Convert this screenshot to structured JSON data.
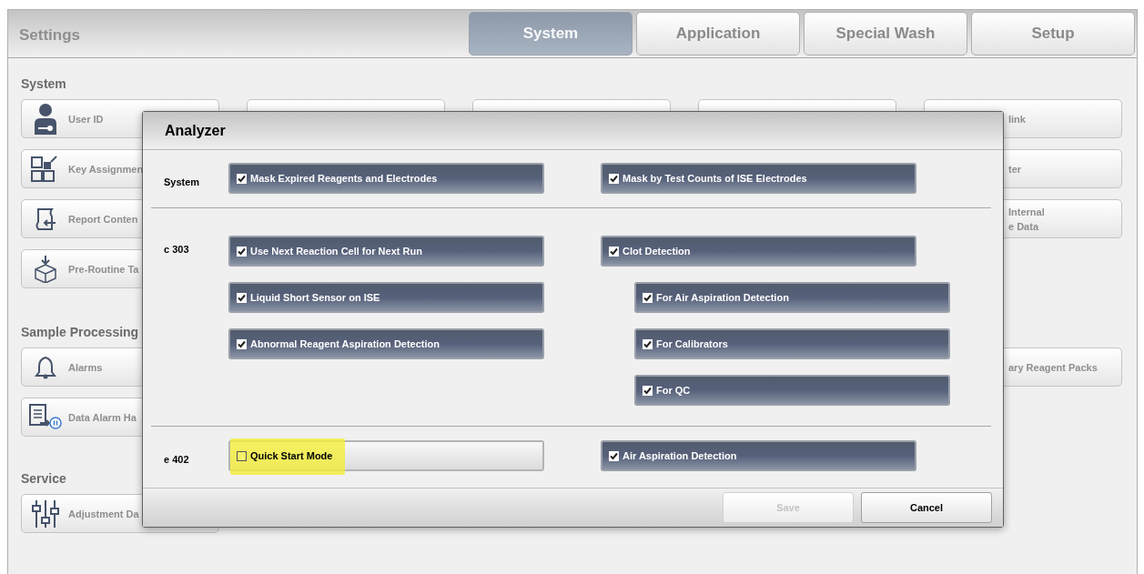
{
  "header": {
    "title": "Settings",
    "tabs": [
      {
        "label": "System",
        "selected": true
      },
      {
        "label": "Application",
        "selected": false
      },
      {
        "label": "Special Wash",
        "selected": false
      },
      {
        "label": "Setup",
        "selected": false
      }
    ]
  },
  "background": {
    "sections": [
      {
        "title": "System",
        "rows": [
          [
            {
              "label": "User ID"
            },
            {},
            {},
            {},
            {
              "label": "link"
            }
          ],
          [
            {
              "label": "Key Assignmen"
            },
            null,
            null,
            null,
            {
              "label": "ter"
            }
          ],
          [
            {
              "label": "Report Conten"
            },
            null,
            null,
            null,
            {
              "label": "Internal\ne Data"
            }
          ],
          [
            {
              "label": "Pre-Routine Ta"
            },
            null,
            null,
            null,
            null
          ]
        ]
      },
      {
        "title": "Sample Processing",
        "rows": [
          [
            {
              "label": "Alarms"
            },
            null,
            null,
            null,
            {
              "label": "ary Reagent Packs"
            }
          ],
          [
            {
              "label": "Data Alarm Ha"
            },
            null,
            null,
            null,
            null
          ]
        ]
      },
      {
        "title": "Service",
        "rows": [
          [
            {
              "label": "Adjustment Da"
            },
            null,
            null,
            null,
            null
          ]
        ]
      }
    ]
  },
  "dialog": {
    "title": "Analyzer",
    "sections": [
      {
        "label": "System",
        "left": [
          {
            "label": "Mask Expired Reagents and Electrodes",
            "checked": true
          }
        ],
        "right": [
          {
            "label": "Mask by Test Counts of ISE Electrodes",
            "checked": true
          }
        ]
      },
      {
        "label": "c 303",
        "left": [
          {
            "label": "Use Next Reaction Cell for Next Run",
            "checked": true
          },
          {
            "label": "Liquid Short Sensor on ISE",
            "checked": true
          },
          {
            "label": "Abnormal Reagent Aspiration Detection",
            "checked": true
          }
        ],
        "right": [
          {
            "label": "Clot Detection",
            "checked": true,
            "children": [
              {
                "label": "For Air Aspiration Detection",
                "checked": true
              },
              {
                "label": "For Calibrators",
                "checked": true
              },
              {
                "label": "For QC",
                "checked": true
              }
            ]
          }
        ]
      },
      {
        "label": "e 402",
        "left": [
          {
            "label": "Quick Start Mode",
            "checked": false,
            "highlighted": true
          }
        ],
        "right": [
          {
            "label": "Air Aspiration Detection",
            "checked": true
          }
        ]
      }
    ],
    "buttons": [
      {
        "label": "Save",
        "disabled": true
      },
      {
        "label": "Cancel",
        "disabled": false
      }
    ]
  }
}
